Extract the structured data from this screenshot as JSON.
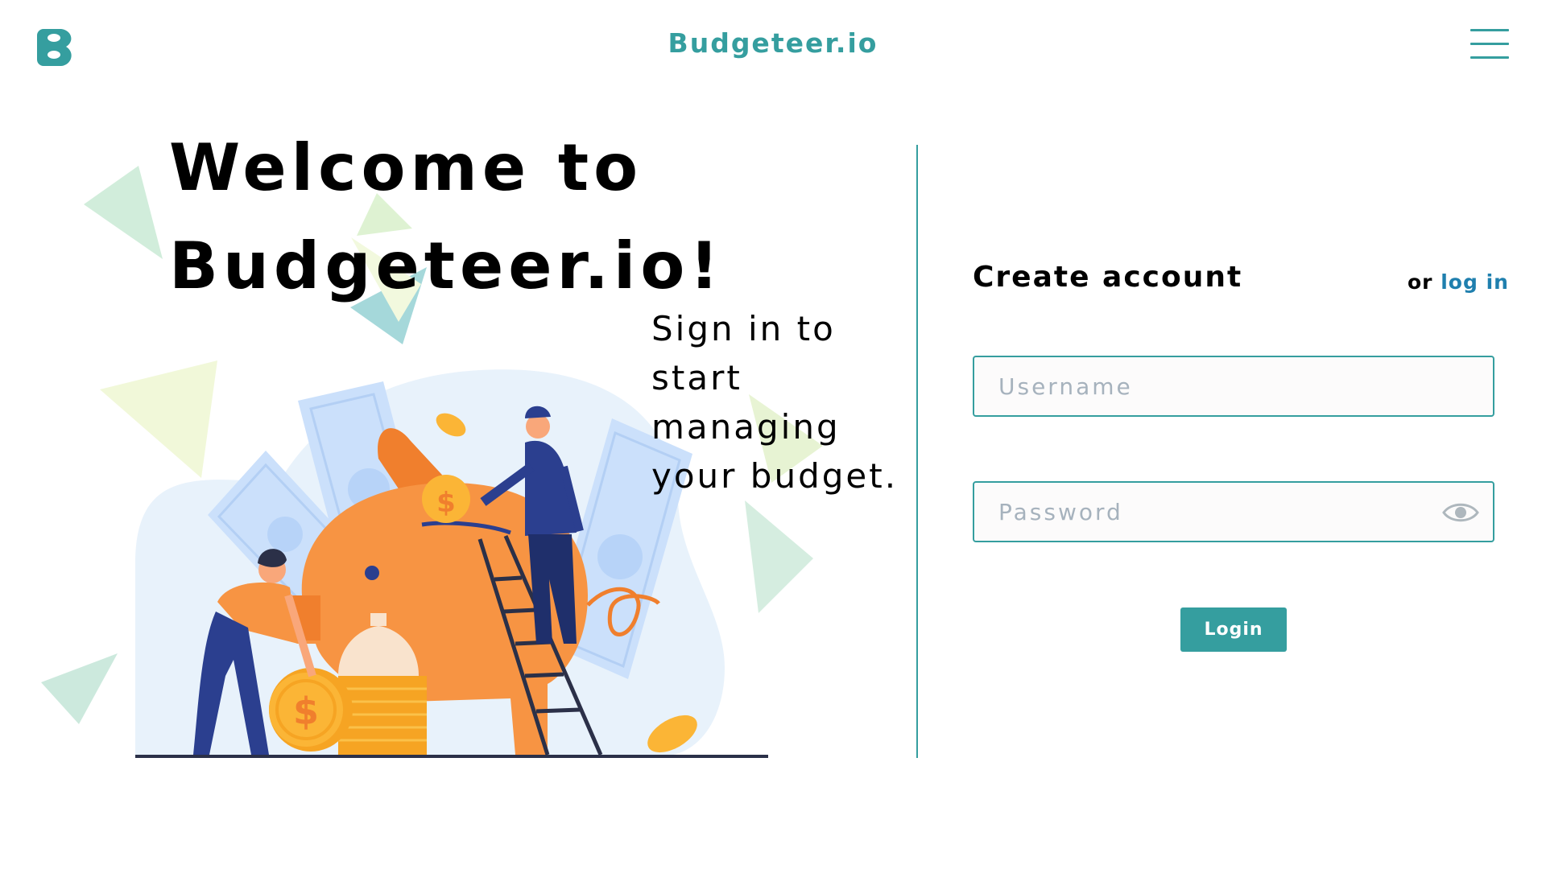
{
  "header": {
    "title": "Budgeteer.io",
    "logo_icon": "b-logo-icon",
    "menu_icon": "hamburger-menu-icon"
  },
  "hero": {
    "welcome_title": "Welcome to\nBudgeteer.io!",
    "tagline": "Sign in to\nstart\nmanaging\nyour budget."
  },
  "form": {
    "title": "Create account",
    "alt_prefix": "or ",
    "alt_link": "log in",
    "username_placeholder": "Username",
    "password_placeholder": "Password",
    "password_toggle_icon": "eye-icon",
    "submit_label": "Login"
  },
  "colors": {
    "accent": "#359e9f",
    "link": "#1f7fae",
    "piggy": "#f79443",
    "coin": "#fbb536",
    "figure_blue": "#2b3f8f"
  }
}
